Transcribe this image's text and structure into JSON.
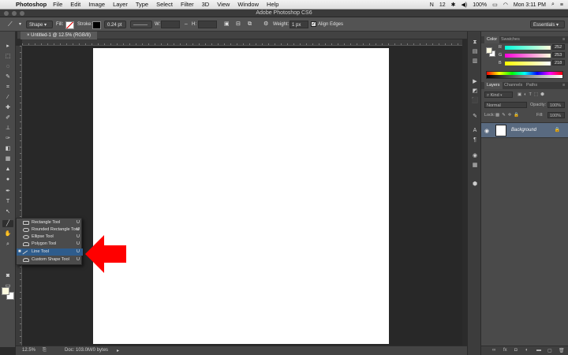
{
  "menubar": {
    "app_name": "Photoshop",
    "items": [
      "File",
      "Edit",
      "Image",
      "Layer",
      "Type",
      "Select",
      "Filter",
      "3D",
      "View",
      "Window",
      "Help"
    ],
    "battery": "100%",
    "clock": "Mon 3:11 PM",
    "notif_count": "12"
  },
  "titlebar": {
    "title": "Adobe Photoshop CS6"
  },
  "options": {
    "mode": "Shape",
    "fill_label": "Fill:",
    "stroke_label": "Stroke:",
    "stroke_width": "0.24 pt",
    "w_label": "W:",
    "h_label": "H:",
    "weight_label": "Weight:",
    "weight_value": "1 px",
    "align_edges_label": "Align Edges",
    "workspace": "Essentials"
  },
  "document": {
    "tab_title": "Untitled-1 @ 12.5% (RGB/8)"
  },
  "status": {
    "zoom": "12.5%",
    "doc_size": "Doc: 103.0M/0 bytes"
  },
  "flyout": {
    "items": [
      {
        "label": "Rectangle Tool",
        "key": "U",
        "selected": false
      },
      {
        "label": "Rounded Rectangle Tool",
        "key": "U",
        "selected": false
      },
      {
        "label": "Ellipse Tool",
        "key": "U",
        "selected": false
      },
      {
        "label": "Polygon Tool",
        "key": "U",
        "selected": false
      },
      {
        "label": "Line Tool",
        "key": "U",
        "selected": true
      },
      {
        "label": "Custom Shape Tool",
        "key": "U",
        "selected": false
      }
    ],
    "bullet": "■"
  },
  "colors": {
    "foreground": "#fefbe0",
    "arrow": "#ff0000",
    "selection": "#2e5c8c",
    "layer_selected": "#596a80"
  },
  "color_panel": {
    "tabs": [
      "Color",
      "Swatches"
    ],
    "r_label": "R",
    "r_value": "252",
    "g_label": "G",
    "g_value": "253",
    "b_label": "B",
    "b_value": "218"
  },
  "layers_panel": {
    "tabs": [
      "Layers",
      "Channels",
      "Paths"
    ],
    "kind_label": "Kind",
    "blend_mode": "Normal",
    "opacity_label": "Opacity:",
    "opacity_value": "100%",
    "lock_label": "Lock:",
    "fill_label": "Fill:",
    "fill_value": "100%",
    "layer_name": "Background",
    "footer_icons": [
      "link-icon",
      "fx-icon",
      "mask-icon",
      "adjustment-icon",
      "folder-icon",
      "new-layer-icon",
      "trash-icon"
    ]
  }
}
